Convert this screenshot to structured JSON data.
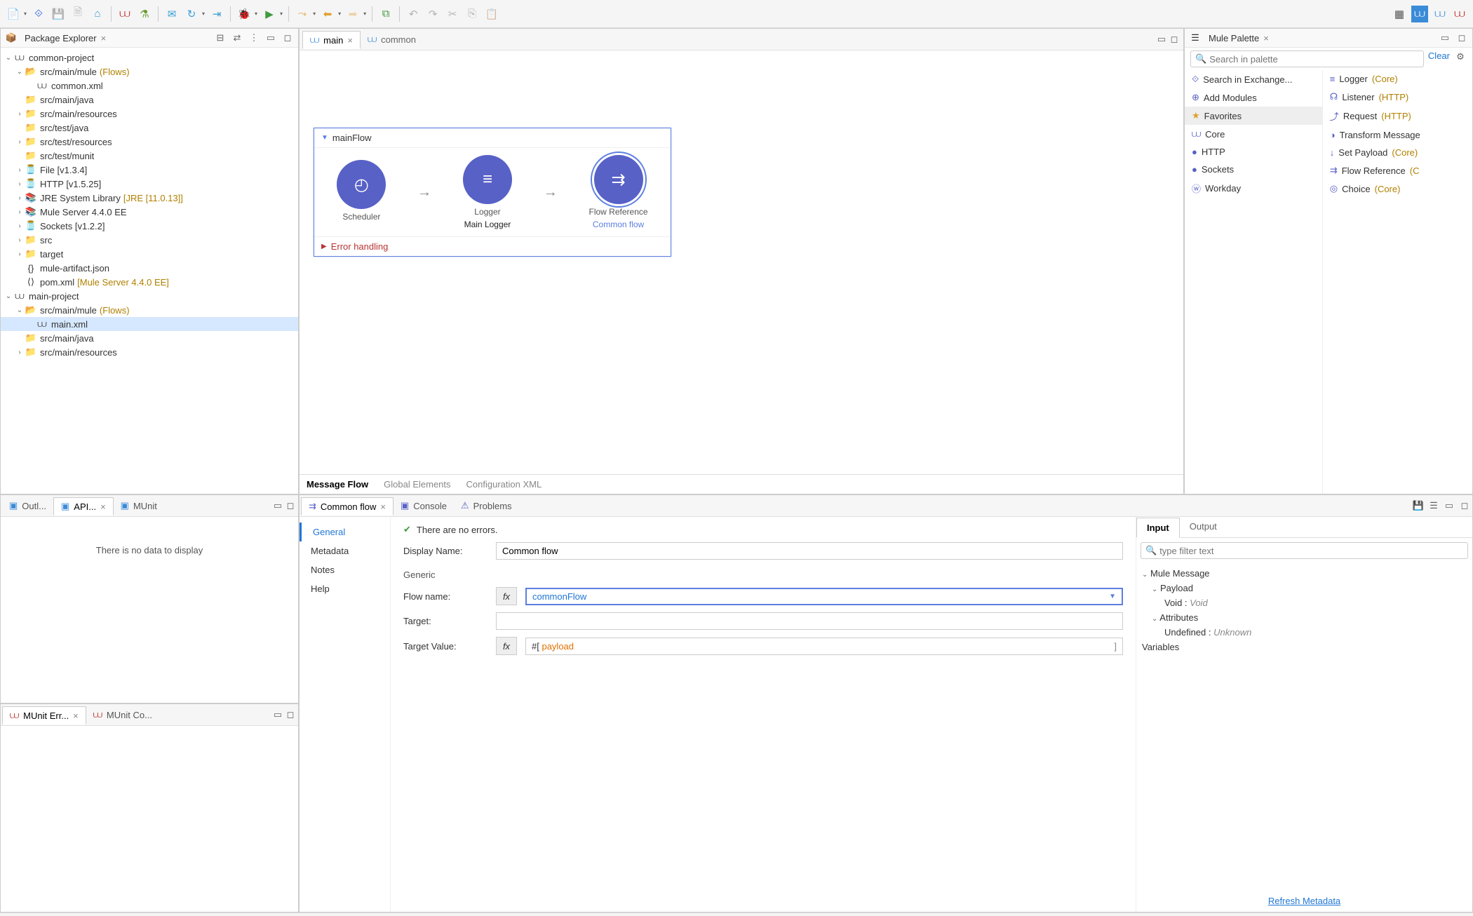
{
  "toolbar": {
    "icons": [
      "new",
      "save",
      "saveall",
      "home",
      "mule",
      "flask",
      "mail",
      "refresh",
      "step",
      "debug",
      "run",
      "skip",
      "back",
      "fwd",
      "newwin",
      "undo",
      "redo",
      "cut",
      "dup",
      "paste"
    ]
  },
  "explorer": {
    "title": "Package Explorer",
    "items": [
      {
        "d": 0,
        "tw": "v",
        "icon": "mule",
        "label": "common-project"
      },
      {
        "d": 1,
        "tw": "v",
        "icon": "folder-o",
        "label": "src/main/mule",
        "decor": "(Flows)"
      },
      {
        "d": 2,
        "tw": "",
        "icon": "mule",
        "label": "common.xml"
      },
      {
        "d": 1,
        "tw": "",
        "icon": "folder",
        "label": "src/main/java"
      },
      {
        "d": 1,
        "tw": ">",
        "icon": "folder",
        "label": "src/main/resources"
      },
      {
        "d": 1,
        "tw": "",
        "icon": "folder",
        "label": "src/test/java"
      },
      {
        "d": 1,
        "tw": ">",
        "icon": "folder",
        "label": "src/test/resources"
      },
      {
        "d": 1,
        "tw": "",
        "icon": "folder",
        "label": "src/test/munit"
      },
      {
        "d": 1,
        "tw": ">",
        "icon": "jar",
        "label": "File [v1.3.4]"
      },
      {
        "d": 1,
        "tw": ">",
        "icon": "jar",
        "label": "HTTP [v1.5.25]"
      },
      {
        "d": 1,
        "tw": ">",
        "icon": "lib",
        "label": "JRE System Library",
        "decor": "[JRE [11.0.13]]"
      },
      {
        "d": 1,
        "tw": ">",
        "icon": "lib",
        "label": "Mule Server 4.4.0 EE"
      },
      {
        "d": 1,
        "tw": ">",
        "icon": "jar",
        "label": "Sockets [v1.2.2]"
      },
      {
        "d": 1,
        "tw": ">",
        "icon": "folder-y",
        "label": "src"
      },
      {
        "d": 1,
        "tw": ">",
        "icon": "folder-y",
        "label": "target"
      },
      {
        "d": 1,
        "tw": "",
        "icon": "json",
        "label": "mule-artifact.json"
      },
      {
        "d": 1,
        "tw": "",
        "icon": "xml",
        "label": "pom.xml",
        "decor": "[Mule Server 4.4.0 EE]"
      },
      {
        "d": 0,
        "tw": "v",
        "icon": "mule",
        "label": "main-project"
      },
      {
        "d": 1,
        "tw": "v",
        "icon": "folder-o",
        "label": "src/main/mule",
        "decor": "(Flows)"
      },
      {
        "d": 2,
        "tw": "",
        "icon": "mule",
        "label": "main.xml",
        "sel": true
      },
      {
        "d": 1,
        "tw": "",
        "icon": "folder",
        "label": "src/main/java"
      },
      {
        "d": 1,
        "tw": ">",
        "icon": "folder",
        "label": "src/main/resources"
      }
    ]
  },
  "editor": {
    "tabs": [
      {
        "label": "main",
        "active": true
      },
      {
        "label": "common"
      }
    ],
    "flow": {
      "title": "mainFlow",
      "nodes": [
        {
          "icon": "sched",
          "label": "Scheduler",
          "sub": ""
        },
        {
          "icon": "log",
          "label": "Logger",
          "sub": "Main Logger"
        },
        {
          "icon": "ref",
          "label": "Flow Reference",
          "sub": "Common flow",
          "sel": true
        }
      ],
      "error": "Error handling"
    },
    "bottom_tabs": [
      {
        "label": "Message Flow",
        "active": true
      },
      {
        "label": "Global Elements"
      },
      {
        "label": "Configuration XML"
      }
    ]
  },
  "palette": {
    "title": "Mule Palette",
    "search_ph": "Search in palette",
    "clear": "Clear",
    "left": [
      {
        "icon": "exch",
        "label": "Search in Exchange..."
      },
      {
        "icon": "add",
        "label": "Add Modules"
      },
      {
        "icon": "star",
        "label": "Favorites",
        "sel": true
      },
      {
        "icon": "mule",
        "label": "Core"
      },
      {
        "icon": "http",
        "label": "HTTP"
      },
      {
        "icon": "sock",
        "label": "Sockets"
      },
      {
        "icon": "wd",
        "label": "Workday"
      }
    ],
    "right": [
      {
        "icon": "log",
        "label": "Logger",
        "tag": "(Core)"
      },
      {
        "icon": "listen",
        "label": "Listener",
        "tag": "(HTTP)"
      },
      {
        "icon": "req",
        "label": "Request",
        "tag": "(HTTP)"
      },
      {
        "icon": "xform",
        "label": "Transform Message"
      },
      {
        "icon": "setp",
        "label": "Set Payload",
        "tag": "(Core)"
      },
      {
        "icon": "fref",
        "label": "Flow Reference",
        "tag": "(C"
      },
      {
        "icon": "choice",
        "label": "Choice",
        "tag": "(Core)"
      }
    ]
  },
  "lower_left": {
    "tabs": [
      {
        "label": "Outl..."
      },
      {
        "label": "API...",
        "active": true
      },
      {
        "label": "MUnit"
      }
    ],
    "nodata": "There is no data to display",
    "tabs2": [
      {
        "label": "MUnit Err...",
        "active": true
      },
      {
        "label": "MUnit Co..."
      }
    ]
  },
  "props": {
    "tabs": [
      {
        "label": "Common flow",
        "active": true,
        "icon": "fref"
      },
      {
        "label": "Console",
        "icon": "cons"
      },
      {
        "label": "Problems",
        "icon": "prob"
      }
    ],
    "status": "There are no errors.",
    "sections": [
      "General",
      "Metadata",
      "Notes",
      "Help"
    ],
    "display_name_label": "Display Name:",
    "display_name": "Common flow",
    "generic_label": "Generic",
    "flow_name_label": "Flow name:",
    "flow_name": "commonFlow",
    "target_label": "Target:",
    "target": "",
    "target_value_label": "Target Value:",
    "target_value_prefix": "#[ ",
    "target_value_expr": "payload",
    "io": {
      "tabs": [
        "Input",
        "Output"
      ],
      "filter_ph": "type filter text",
      "tree": [
        {
          "d": 0,
          "tw": "v",
          "label": "Mule Message"
        },
        {
          "d": 1,
          "tw": "v",
          "label": "Payload"
        },
        {
          "d": 2,
          "tw": "",
          "label": "Void :",
          "val": "Void"
        },
        {
          "d": 1,
          "tw": "v",
          "label": "Attributes"
        },
        {
          "d": 2,
          "tw": "",
          "label": "Undefined :",
          "val": "Unknown"
        },
        {
          "d": 0,
          "tw": "",
          "label": "Variables"
        }
      ],
      "refresh": "Refresh Metadata"
    }
  }
}
